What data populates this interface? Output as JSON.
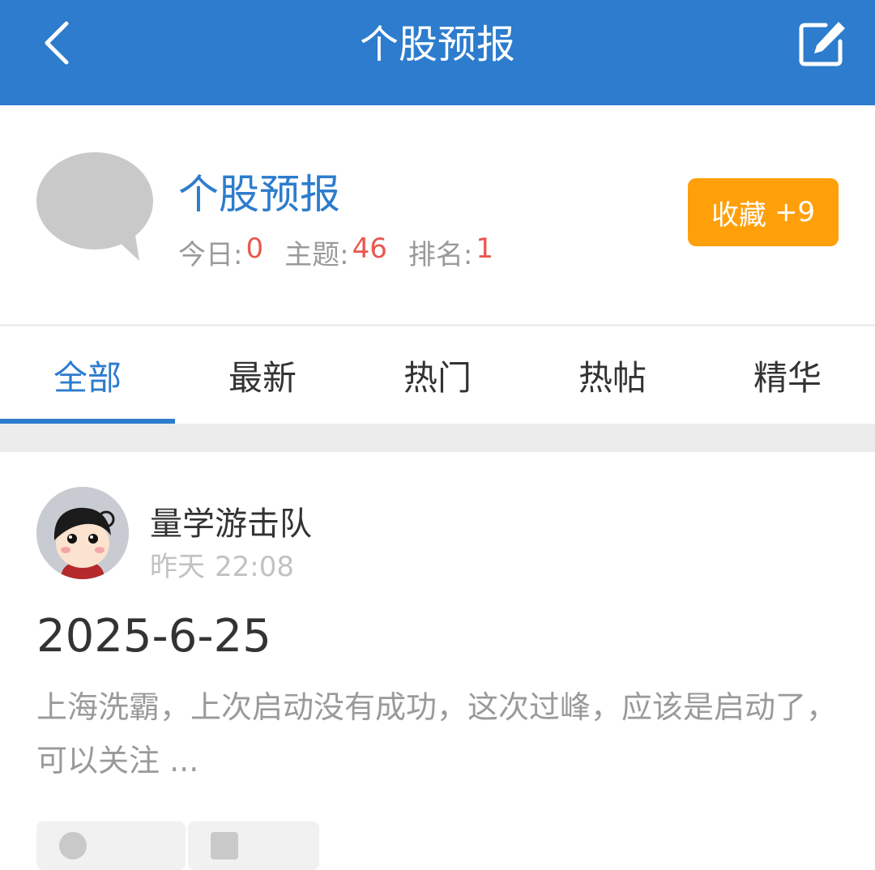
{
  "nav": {
    "title": "个股预报",
    "back_icon": "chevron-left-icon",
    "edit_icon": "edit-icon"
  },
  "forum": {
    "name": "个股预报",
    "icon": "speech-bubble-icon",
    "stats": {
      "today_label": "今日:",
      "today_value": "0",
      "topics_label": "主题:",
      "topics_value": "46",
      "rank_label": "排名:",
      "rank_value": "1"
    },
    "favorite_label": "收藏",
    "favorite_count": "+9"
  },
  "tabs": [
    {
      "label": "全部",
      "active": true
    },
    {
      "label": "最新",
      "active": false
    },
    {
      "label": "热门",
      "active": false
    },
    {
      "label": "热帖",
      "active": false
    },
    {
      "label": "精华",
      "active": false
    }
  ],
  "post": {
    "author": "量学游击队",
    "day": "昨天",
    "time": "22:08",
    "title": "2025-6-25",
    "excerpt": "上海洗霸，上次启动没有成功，这次过峰，应该是启动了，可以关注 ...",
    "views_icon": "eye-icon",
    "replies_icon": "comment-icon"
  },
  "colors": {
    "primary": "#2d7ccd",
    "accent": "#ff9f0a",
    "stat_value": "#e8584f",
    "muted": "#9a9a9a"
  }
}
